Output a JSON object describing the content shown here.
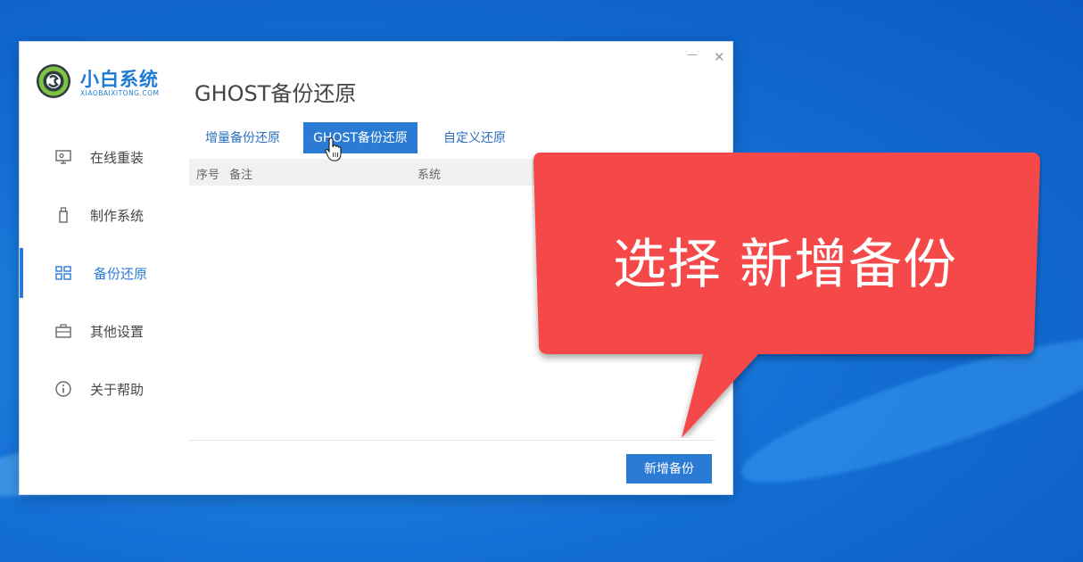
{
  "app": {
    "logo_title": "小白系统",
    "logo_subtitle": "XIAOBAIXITONG.COM",
    "window_controls": {
      "minimize": "—",
      "close": "✕"
    }
  },
  "sidebar": {
    "items": [
      {
        "label": "在线重装",
        "icon": "monitor-icon",
        "active": false
      },
      {
        "label": "制作系统",
        "icon": "usb-drive-icon",
        "active": false
      },
      {
        "label": "备份还原",
        "icon": "grid-icon",
        "active": true
      },
      {
        "label": "其他设置",
        "icon": "briefcase-icon",
        "active": false
      },
      {
        "label": "关于帮助",
        "icon": "info-icon",
        "active": false
      }
    ]
  },
  "main": {
    "title": "GHOST备份还原",
    "tabs": [
      {
        "label": "增量备份还原",
        "active": false
      },
      {
        "label": "GHOST备份还原",
        "active": true
      },
      {
        "label": "自定义还原",
        "active": false
      }
    ],
    "table": {
      "columns": [
        "序号",
        "备注",
        "系统"
      ],
      "rows": []
    },
    "add_button": "新增备份"
  },
  "callout": {
    "text": "选择 新增备份"
  },
  "colors": {
    "accent": "#2b7bd4",
    "callout": "#f54848",
    "desktop": "#1470d6"
  }
}
